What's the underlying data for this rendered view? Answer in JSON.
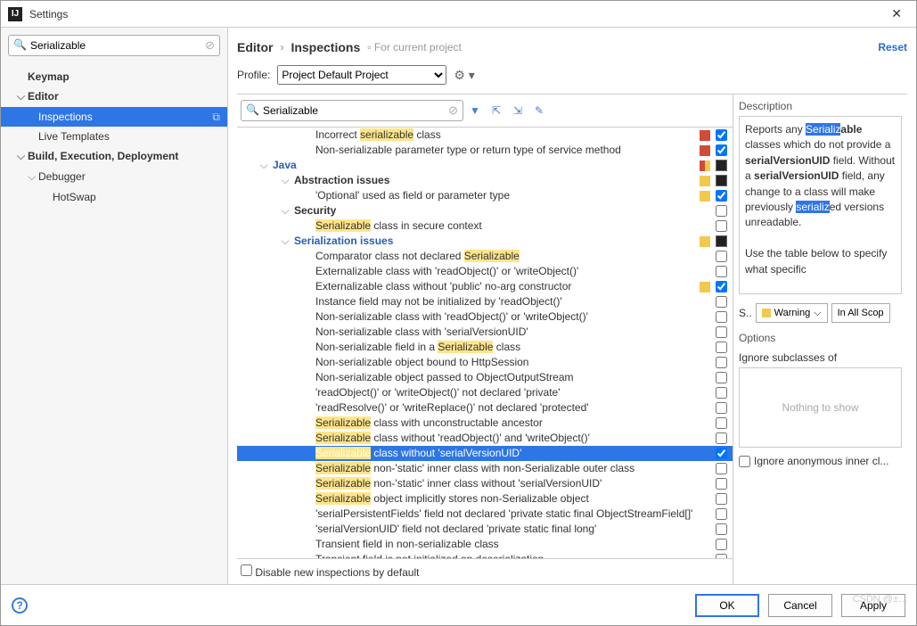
{
  "window": {
    "title": "Settings"
  },
  "sidebar": {
    "search": "Serializable",
    "items": [
      {
        "label": "Keymap",
        "bold": true,
        "lvl": 0
      },
      {
        "label": "Editor",
        "bold": true,
        "lvl": 0,
        "chev": "⌵"
      },
      {
        "label": "Inspections",
        "lvl": 1,
        "selected": true,
        "copy": true
      },
      {
        "label": "Live Templates",
        "lvl": 1
      },
      {
        "label": "Build, Execution, Deployment",
        "bold": true,
        "lvl": 0,
        "chev": "⌵"
      },
      {
        "label": "Debugger",
        "lvl": 1,
        "chev": "⌵"
      },
      {
        "label": "HotSwap",
        "lvl": 2
      }
    ]
  },
  "breadcrumb": {
    "a": "Editor",
    "b": "Inspections",
    "hint": "For current project",
    "reset": "Reset"
  },
  "profile": {
    "label": "Profile:",
    "value": "Project Default  Project"
  },
  "toolbar": {
    "search": "Serializable"
  },
  "inspections": [
    {
      "ind": 3,
      "text": "Incorrect |serializable| class",
      "sev": "err",
      "cb": "on"
    },
    {
      "ind": 3,
      "text": "Non-serializable parameter type or return type of service method",
      "sev": "err",
      "cb": "on"
    },
    {
      "ind": 1,
      "chev": "⌵",
      "text": "Java",
      "blue": true,
      "sev": "mixed",
      "cb": "mixed"
    },
    {
      "ind": 2,
      "chev": "⌵",
      "text": "Abstraction issues",
      "bold": true,
      "sev": "warn",
      "cb": "mixed"
    },
    {
      "ind": 3,
      "text": "'Optional' used as field or parameter type",
      "sev": "warn",
      "cb": "on"
    },
    {
      "ind": 2,
      "chev": "⌵",
      "text": "Security",
      "bold": true,
      "cb": "off"
    },
    {
      "ind": 3,
      "text": "|Serializable| class in secure context",
      "cb": "off"
    },
    {
      "ind": 2,
      "chev": "⌵",
      "text": "Serialization issues",
      "blue": true,
      "sev": "warn",
      "cb": "mixed"
    },
    {
      "ind": 3,
      "text": "Comparator class not declared |Serializable|",
      "cb": "off"
    },
    {
      "ind": 3,
      "text": "Externalizable class with 'readObject()' or 'writeObject()'",
      "cb": "off"
    },
    {
      "ind": 3,
      "text": "Externalizable class without 'public' no-arg constructor",
      "sev": "warn",
      "cb": "on"
    },
    {
      "ind": 3,
      "text": "Instance field may not be initialized by 'readObject()'",
      "cb": "off"
    },
    {
      "ind": 3,
      "text": "Non-serializable class with 'readObject()' or 'writeObject()'",
      "cb": "off"
    },
    {
      "ind": 3,
      "text": "Non-serializable class with 'serialVersionUID'",
      "cb": "off"
    },
    {
      "ind": 3,
      "text": "Non-serializable field in a |Serializable| class",
      "cb": "off"
    },
    {
      "ind": 3,
      "text": "Non-serializable object bound to HttpSession",
      "cb": "off"
    },
    {
      "ind": 3,
      "text": "Non-serializable object passed to ObjectOutputStream",
      "cb": "off"
    },
    {
      "ind": 3,
      "text": "'readObject()' or 'writeObject()' not declared 'private'",
      "cb": "off"
    },
    {
      "ind": 3,
      "text": "'readResolve()' or 'writeReplace()' not declared 'protected'",
      "cb": "off"
    },
    {
      "ind": 3,
      "text": "|Serializable| class with unconstructable ancestor",
      "cb": "off"
    },
    {
      "ind": 3,
      "text": "|Serializable| class without 'readObject()' and 'writeObject()'",
      "cb": "off"
    },
    {
      "ind": 3,
      "text": "|Serializable| class without 'serialVersionUID'",
      "selected": true,
      "cb": "on"
    },
    {
      "ind": 3,
      "text": "|Serializable| non-'static' inner class with non-Serializable outer class",
      "cb": "off"
    },
    {
      "ind": 3,
      "text": "|Serializable| non-'static' inner class without 'serialVersionUID'",
      "cb": "off"
    },
    {
      "ind": 3,
      "text": "|Serializable| object implicitly stores non-Serializable object",
      "cb": "off"
    },
    {
      "ind": 3,
      "text": "'serialPersistentFields' field not declared 'private static final ObjectStreamField[]'",
      "cb": "off"
    },
    {
      "ind": 3,
      "text": "'serialVersionUID' field not declared 'private static final long'",
      "cb": "off"
    },
    {
      "ind": 3,
      "text": "Transient field in non-serializable class",
      "cb": "off"
    },
    {
      "ind": 3,
      "text": "Transient field is not initialized on deserialization",
      "cb": "off"
    }
  ],
  "disable": "Disable new inspections by default",
  "description": {
    "title": "Description",
    "html": "Reports any <span class='bl'>Serializ</span><b>able</b> classes which do not provide a <b>serialVersionUID</b> field. Without a <b>serialVersionUID</b> field, any change to a class will make previously <span class='bl'>serializ</span>ed versions unreadable.<br><br>Use the table below to specify what specific"
  },
  "severity": {
    "label": "S..",
    "value": "Warning",
    "scope": "In All Scop"
  },
  "options": {
    "title": "Options",
    "ignoreSub": "Ignore subclasses of",
    "empty": "Nothing to show",
    "ignoreAnon": "Ignore anonymous inner cl..."
  },
  "footer": {
    "ok": "OK",
    "cancel": "Cancel",
    "apply": "Apply"
  },
  "watermark": "CSDN @±…"
}
